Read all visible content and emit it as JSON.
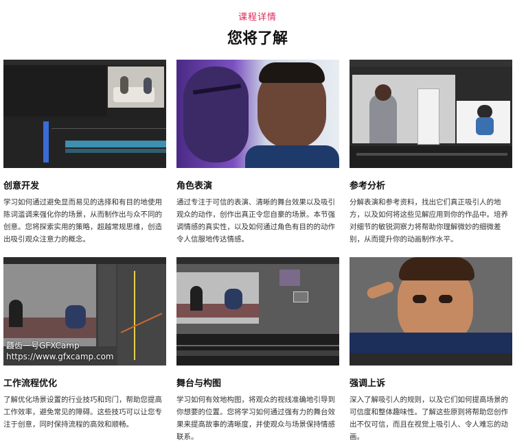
{
  "header": {
    "kicker": "课程详情",
    "title": "您将了解"
  },
  "cards": [
    {
      "title": "创意开发",
      "body": "学习如何通过避免显而易见的选择和有目的地使用陈词滥调来强化你的场景，从而制作出与众不同的创意。您将探索实用的策略，超越常规思维，创造出吸引观众注意力的概念。"
    },
    {
      "title": "角色表演",
      "body": "通过专注于可信的表演、清晰的舞台效果以及吸引观众的动作，创作出真正令您自豪的场景。本节强调情感的真实性，以及如何通过角色有目的的动作令人信服地传达情感。"
    },
    {
      "title": "参考分析",
      "body": "分解表演和参考资料，找出它们真正吸引人的地方，以及如何将这些见解应用到你的作品中。培养对细节的敏锐洞察力将帮助你理解微妙的细微差别，从而提升你的动画制作水平。"
    },
    {
      "title": "工作流程优化",
      "body": "了解优化场景设置的行业技巧和窍门，帮助您提高工作效率，避免常见的障碍。这些技巧可以让您专注于创意，同时保持流程的高效和顺畅。",
      "watermark_line1": "龘齿一号GFXCamp",
      "watermark_line2": "https://www.gfxcamp.com"
    },
    {
      "title": "舞台与构图",
      "body": "学习如何有效地构图，将观众的视线准确地引导到你想要的位置。您将学习如何通过强有力的舞台效果来提高故事的清晰度，并使观众与场景保持情感联系。"
    },
    {
      "title": "强调上诉",
      "body": "深入了解吸引人的规则，以及它们如何提高场景的可信度和整体趣味性。了解这些原则将帮助您创作出不仅可信，而且在视觉上吸引人、令人难忘的动画。"
    }
  ]
}
